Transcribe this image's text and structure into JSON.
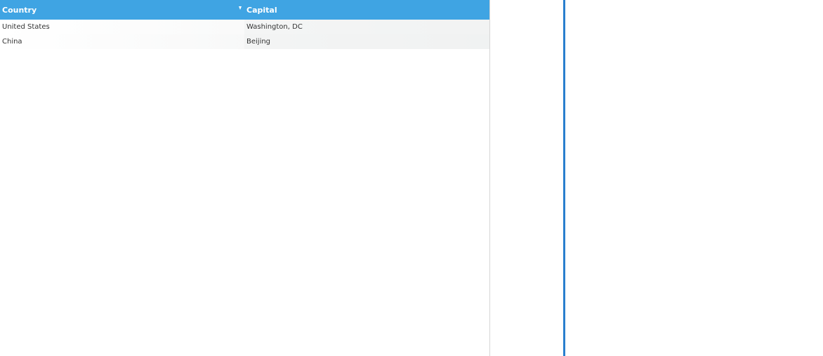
{
  "grid": {
    "columns": [
      {
        "label": "Country"
      },
      {
        "label": "Capital"
      }
    ],
    "sort_icon": "sort-down-triangle-icon",
    "rows": [
      {
        "country": "United States",
        "capital": "Washington, DC"
      },
      {
        "country": "China",
        "capital": "Beijing"
      }
    ]
  },
  "colors": {
    "header_bg": "#3fa4e3",
    "splitter": "#2a7fce"
  }
}
